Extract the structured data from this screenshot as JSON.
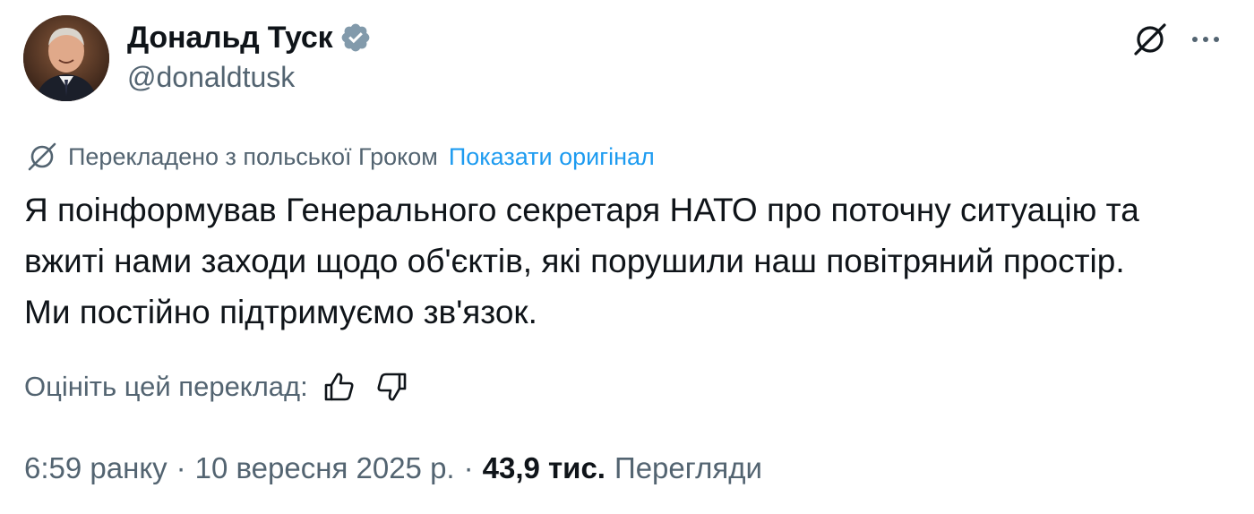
{
  "author": {
    "name": "Дональд Туск",
    "handle": "@donaldtusk"
  },
  "translation": {
    "note": "Перекладено з польської Гроком",
    "show_original": "Показати оригінал"
  },
  "body_lines": [
    "Я поінформував Генерального секретаря НАТО про поточну ситуацію та",
    "вжиті нами заходи щодо об'єктів, які порушили наш повітряний простір.",
    "Ми постійно підтримуємо зв'язок."
  ],
  "rate": {
    "label": "Оцініть цей переклад:"
  },
  "meta": {
    "time": "6:59 ранку",
    "separator": "·",
    "date": "10 вересня 2025 р.",
    "views_count": "43,9 тис.",
    "views_label": "Перегляди"
  },
  "icons": {
    "verified": "verified-badge-icon",
    "grok": "grok-icon",
    "more": "more-horizontal-icon",
    "like": "thumbs-up-icon",
    "dislike": "thumbs-down-icon"
  },
  "colors": {
    "text": "#0f1419",
    "secondary": "#536471",
    "link": "#1d9bf0",
    "verified_badge": "#829aab"
  }
}
